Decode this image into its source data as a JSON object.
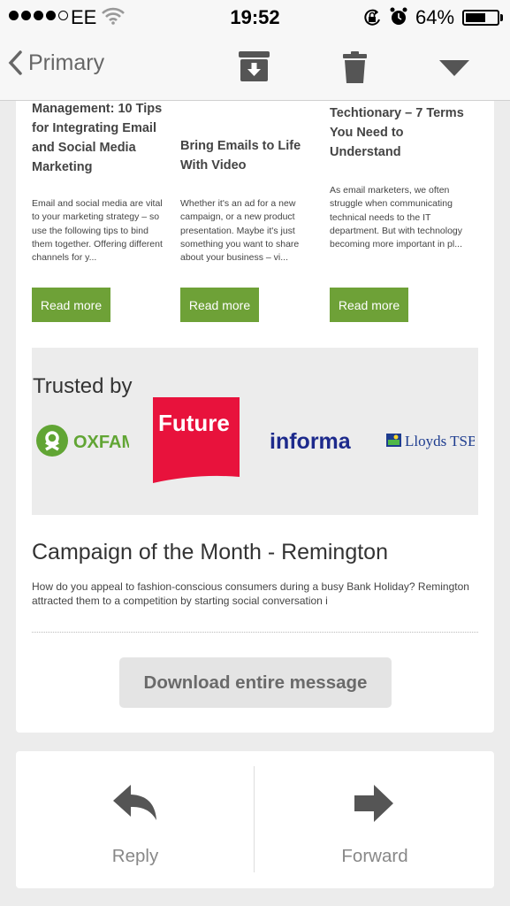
{
  "status_bar": {
    "carrier": "EE",
    "time": "19:52",
    "battery_percent": "64%",
    "battery_level": 0.64,
    "signal_bars_filled": 4,
    "signal_bars_total": 5
  },
  "nav": {
    "back_label": "Primary",
    "icons": [
      "chevron-left-icon",
      "archive-icon",
      "trash-icon",
      "caret-down-icon"
    ]
  },
  "articles": [
    {
      "title": "Management: 10 Tips for Integrating Email and Social Media Marketing",
      "body": "Email and social media are vital to your marketing strategy – so use the following tips to bind them together. Offering different channels for y...",
      "button": "Read more"
    },
    {
      "title": "Bring Emails to Life With Video",
      "body": "Whether it's an ad for a new campaign, or a new product presentation. Maybe it's just something you want to share about your business – vi...",
      "button": "Read more"
    },
    {
      "title": "Techtionary – 7 Terms You Need to Understand",
      "body": "As email marketers, we often struggle when communicating technical needs to the IT department. But with technology becoming more important in pl...",
      "button": "Read more"
    }
  ],
  "trusted": {
    "title": "Trusted by",
    "logos": [
      "OXFAM",
      "Future",
      "informa",
      "Lloyds TSB"
    ]
  },
  "campaign": {
    "title": "Campaign of the Month - Remington",
    "body": "How do you appeal to fashion-conscious consumers during a busy Bank Holiday? Remington attracted them to a competition by starting social conversation i"
  },
  "download_button": "Download entire message",
  "actions": {
    "reply": "Reply",
    "forward": "Forward"
  },
  "colors": {
    "accent_green": "#6ea137",
    "future_red": "#e8123c",
    "informa_blue": "#1d2a8c",
    "oxfam_green": "#61a534",
    "lloyds_blue": "#1d3c8f"
  }
}
